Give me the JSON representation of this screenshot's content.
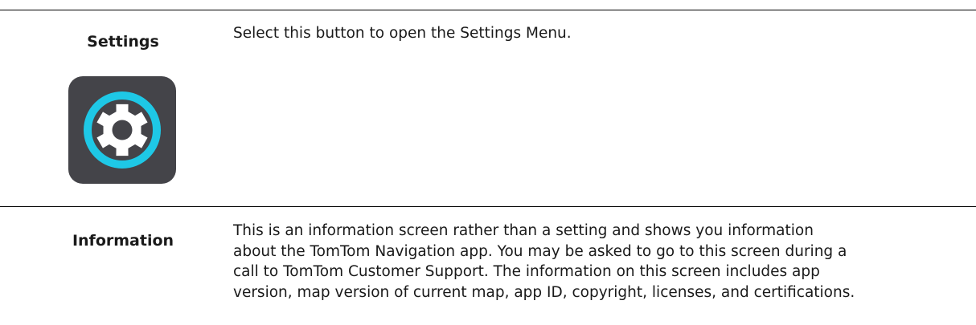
{
  "rows": [
    {
      "label": "Settings",
      "text": "Select this button to open the Settings Menu.",
      "icon": "gear-icon"
    },
    {
      "label": "Information",
      "lines": [
        "This is an information screen rather than a setting and shows you information",
        "about the TomTom Navigation app. You may be asked to go to this screen during a",
        "call to TomTom Customer Support. The information on this screen includes app",
        "version, map version of current map, app ID, copyright, licenses, and certifications."
      ]
    }
  ],
  "colors": {
    "tile": "#444449",
    "accent": "#1ec8e6",
    "gear": "#ffffff"
  }
}
